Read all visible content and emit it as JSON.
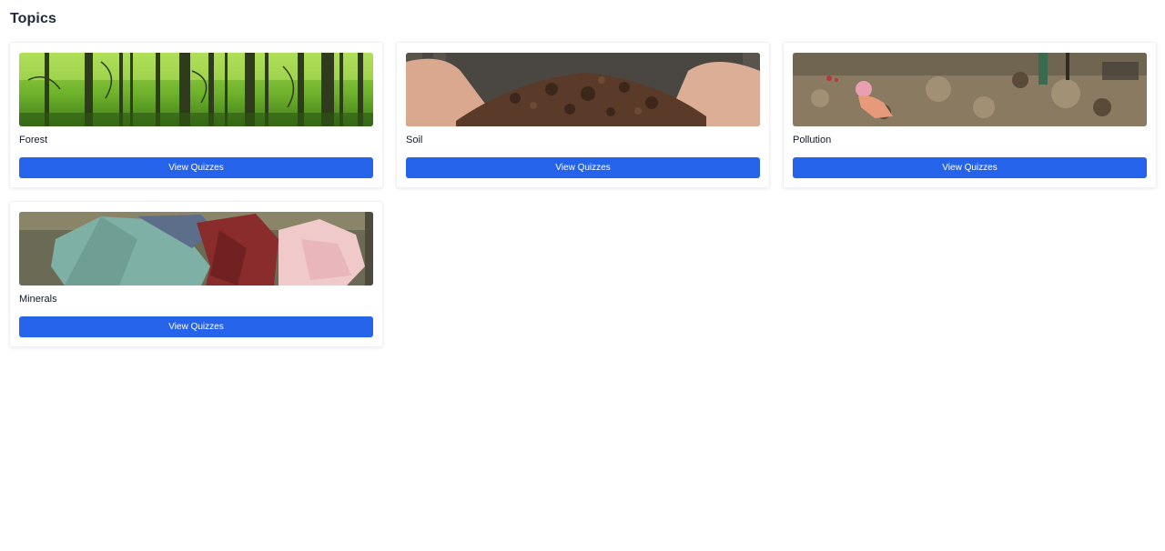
{
  "page": {
    "title": "Topics"
  },
  "topics": [
    {
      "name": "Forest",
      "button_label": "View Quizzes",
      "image": "forest-image"
    },
    {
      "name": "Soil",
      "button_label": "View Quizzes",
      "image": "soil-image"
    },
    {
      "name": "Pollution",
      "button_label": "View Quizzes",
      "image": "pollution-image"
    },
    {
      "name": "Minerals",
      "button_label": "View Quizzes",
      "image": "minerals-image"
    }
  ],
  "colors": {
    "accent": "#2563eb",
    "title": "#1f2937",
    "card_border": "#eef0f3"
  }
}
